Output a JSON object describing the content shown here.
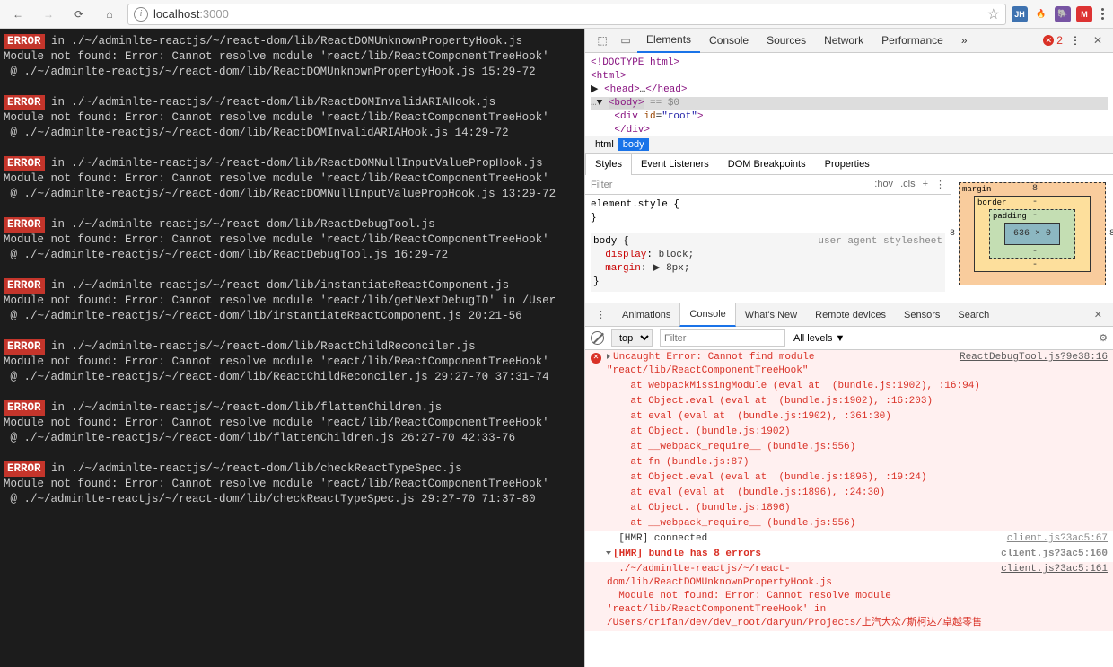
{
  "browser": {
    "url_host": "localhost",
    "url_port": ":3000",
    "extensions": [
      {
        "label": "JH",
        "bg": "#3e72b0"
      },
      {
        "label": "🔥",
        "bg": "transparent"
      },
      {
        "label": "🐘",
        "bg": "#7754a3"
      },
      {
        "label": "M",
        "bg": "#d33"
      }
    ]
  },
  "terminal": {
    "errors": [
      {
        "in": "./~/adminlte-reactjs/~/react-dom/lib/ReactDOMUnknownPropertyHook.js",
        "msg": "Module not found: Error: Cannot resolve module 'react/lib/ReactComponentTreeHook'",
        "at": "@ ./~/adminlte-reactjs/~/react-dom/lib/ReactDOMUnknownPropertyHook.js 15:29-72"
      },
      {
        "in": "./~/adminlte-reactjs/~/react-dom/lib/ReactDOMInvalidARIAHook.js",
        "msg": "Module not found: Error: Cannot resolve module 'react/lib/ReactComponentTreeHook'",
        "at": "@ ./~/adminlte-reactjs/~/react-dom/lib/ReactDOMInvalidARIAHook.js 14:29-72"
      },
      {
        "in": "./~/adminlte-reactjs/~/react-dom/lib/ReactDOMNullInputValuePropHook.js",
        "msg": "Module not found: Error: Cannot resolve module 'react/lib/ReactComponentTreeHook'",
        "at": "@ ./~/adminlte-reactjs/~/react-dom/lib/ReactDOMNullInputValuePropHook.js 13:29-72"
      },
      {
        "in": "./~/adminlte-reactjs/~/react-dom/lib/ReactDebugTool.js",
        "msg": "Module not found: Error: Cannot resolve module 'react/lib/ReactComponentTreeHook'",
        "at": "@ ./~/adminlte-reactjs/~/react-dom/lib/ReactDebugTool.js 16:29-72"
      },
      {
        "in": "./~/adminlte-reactjs/~/react-dom/lib/instantiateReactComponent.js",
        "msg": "Module not found: Error: Cannot resolve module 'react/lib/getNextDebugID' in /User",
        "at": "@ ./~/adminlte-reactjs/~/react-dom/lib/instantiateReactComponent.js 20:21-56"
      },
      {
        "in": "./~/adminlte-reactjs/~/react-dom/lib/ReactChildReconciler.js",
        "msg": "Module not found: Error: Cannot resolve module 'react/lib/ReactComponentTreeHook'",
        "at": "@ ./~/adminlte-reactjs/~/react-dom/lib/ReactChildReconciler.js 29:27-70 37:31-74"
      },
      {
        "in": "./~/adminlte-reactjs/~/react-dom/lib/flattenChildren.js",
        "msg": "Module not found: Error: Cannot resolve module 'react/lib/ReactComponentTreeHook'",
        "at": "@ ./~/adminlte-reactjs/~/react-dom/lib/flattenChildren.js 26:27-70 42:33-76"
      },
      {
        "in": "./~/adminlte-reactjs/~/react-dom/lib/checkReactTypeSpec.js",
        "msg": "Module not found: Error: Cannot resolve module 'react/lib/ReactComponentTreeHook'",
        "at": "@ ./~/adminlte-reactjs/~/react-dom/lib/checkReactTypeSpec.js 29:27-70 71:37-80"
      }
    ]
  },
  "devtools": {
    "tabs": [
      "Elements",
      "Console",
      "Sources",
      "Network",
      "Performance"
    ],
    "active_tab": "Elements",
    "error_count": "2",
    "dom_lines": {
      "l0": "<!DOCTYPE html>",
      "l1_open": "<html>",
      "l2": "▶ <head>…</head>",
      "l3_pre": "…▼ ",
      "l3_body": "<body>",
      "l3_after": " == $0",
      "l4": "    <div id=\"root\">",
      "l5": "    </div>"
    },
    "breadcrumbs": [
      "html",
      "body"
    ],
    "styles_tabs": [
      "Styles",
      "Event Listeners",
      "DOM Breakpoints",
      "Properties"
    ],
    "filter_placeholder": "Filter",
    "filter_btns": [
      ":hov",
      ".cls",
      "+"
    ],
    "rules": {
      "element_style": "element.style {\n}",
      "body_sel": "body {",
      "ua": "user agent stylesheet",
      "p1k": "display",
      "p1v": "block;",
      "p2k": "margin",
      "p2v": "▶ 8px;",
      "close": "}"
    },
    "box": {
      "margin": "margin",
      "margin_t": "8",
      "margin_side": "8",
      "border": "border",
      "border_v": "-",
      "padding": "padding",
      "padding_v": "-",
      "content": "636 × 0"
    },
    "drawer_tabs": [
      "Animations",
      "Console",
      "What's New",
      "Remote devices",
      "Sensors",
      "Search"
    ],
    "drawer_active": "Console",
    "console_ctx": "top",
    "console_filter": "Filter",
    "console_levels": "All levels ▼",
    "console": {
      "err_head": "Uncaught Error: Cannot find module \"react/lib/ReactComponentTreeHook\"",
      "err_src": "ReactDebugTool.js?9e38:16",
      "trace": [
        "    at webpackMissingModule (eval at <anonymous> (bundle.js:1902), <anonymous>:16:94)",
        "    at Object.eval (eval at <anonymous> (bundle.js:1902), <anonymous>:16:203)",
        "    at eval (eval at <anonymous> (bundle.js:1902), <anonymous>:361:30)",
        "    at Object.<anonymous> (bundle.js:1902)",
        "    at __webpack_require__ (bundle.js:556)",
        "    at fn (bundle.js:87)",
        "    at Object.eval (eval at <anonymous> (bundle.js:1896), <anonymous>:19:24)",
        "    at eval (eval at <anonymous> (bundle.js:1896), <anonymous>:24:30)",
        "    at Object.<anonymous> (bundle.js:1896)",
        "    at __webpack_require__ (bundle.js:556)"
      ],
      "hmr1": "[HMR] connected",
      "hmr1_src": "client.js?3ac5:67",
      "hmr2": "[HMR] bundle has 8 errors",
      "hmr2_src": "client.js?3ac5:160",
      "hmr3": "./~/adminlte-reactjs/~/react-dom/lib/ReactDOMUnknownPropertyHook.js\nModule not found: Error: Cannot resolve module 'react/lib/ReactComponentTreeHook' in /Users/crifan/dev/dev_root/daryun/Projects/上汽大众/斯柯达/卓越零售",
      "hmr3_src": "client.js?3ac5:161"
    }
  }
}
